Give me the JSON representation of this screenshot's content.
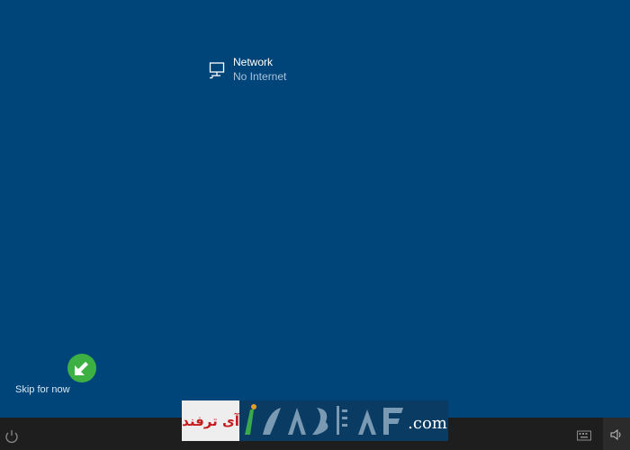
{
  "network": {
    "title": "Network",
    "status": "No Internet"
  },
  "skip": {
    "label": "Skip for now"
  },
  "icons": {
    "network": "network-computer-icon",
    "power": "power-icon",
    "keyboard": "keyboard-icon",
    "volume": "volume-icon",
    "pointer": "arrow-pointer-icon"
  },
  "watermark": {
    "persian_text": "آی ترفند",
    "latin_text": ".com"
  },
  "colors": {
    "background": "#00457a",
    "taskbar": "#1e1e1e",
    "pointer": "#3cb043"
  }
}
